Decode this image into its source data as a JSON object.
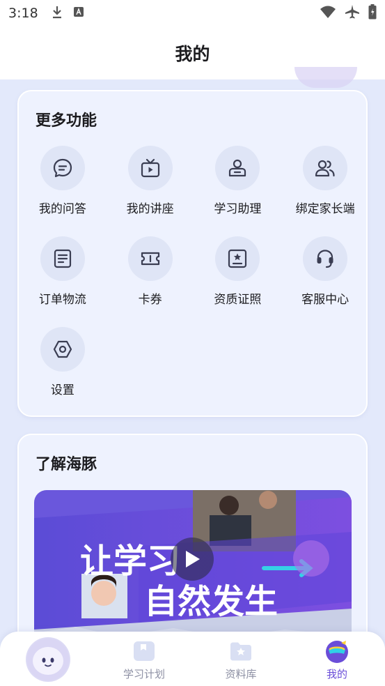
{
  "status_bar": {
    "time": "3:18"
  },
  "header": {
    "title": "我的"
  },
  "features": {
    "title": "更多功能",
    "items": [
      {
        "label": "我的问答",
        "icon": "chat-bubble-icon"
      },
      {
        "label": "我的讲座",
        "icon": "tv-icon"
      },
      {
        "label": "学习助理",
        "icon": "assistant-icon"
      },
      {
        "label": "绑定家长端",
        "icon": "users-icon"
      },
      {
        "label": "订单物流",
        "icon": "order-icon"
      },
      {
        "label": "卡券",
        "icon": "ticket-icon"
      },
      {
        "label": "资质证照",
        "icon": "certificate-icon"
      },
      {
        "label": "客服中心",
        "icon": "headset-icon"
      },
      {
        "label": "设置",
        "icon": "settings-icon"
      }
    ]
  },
  "about": {
    "title": "了解海豚",
    "video_text": [
      "让学习",
      "自然发生"
    ]
  },
  "bottom_nav": {
    "items": [
      {
        "label": "学习计划",
        "active": false
      },
      {
        "label": "资料库",
        "active": false
      },
      {
        "label": "我的",
        "active": true
      }
    ]
  },
  "colors": {
    "accent": "#6a4dd8",
    "icon_stroke": "#3a3d52",
    "card_bg": "#eef2fe"
  }
}
